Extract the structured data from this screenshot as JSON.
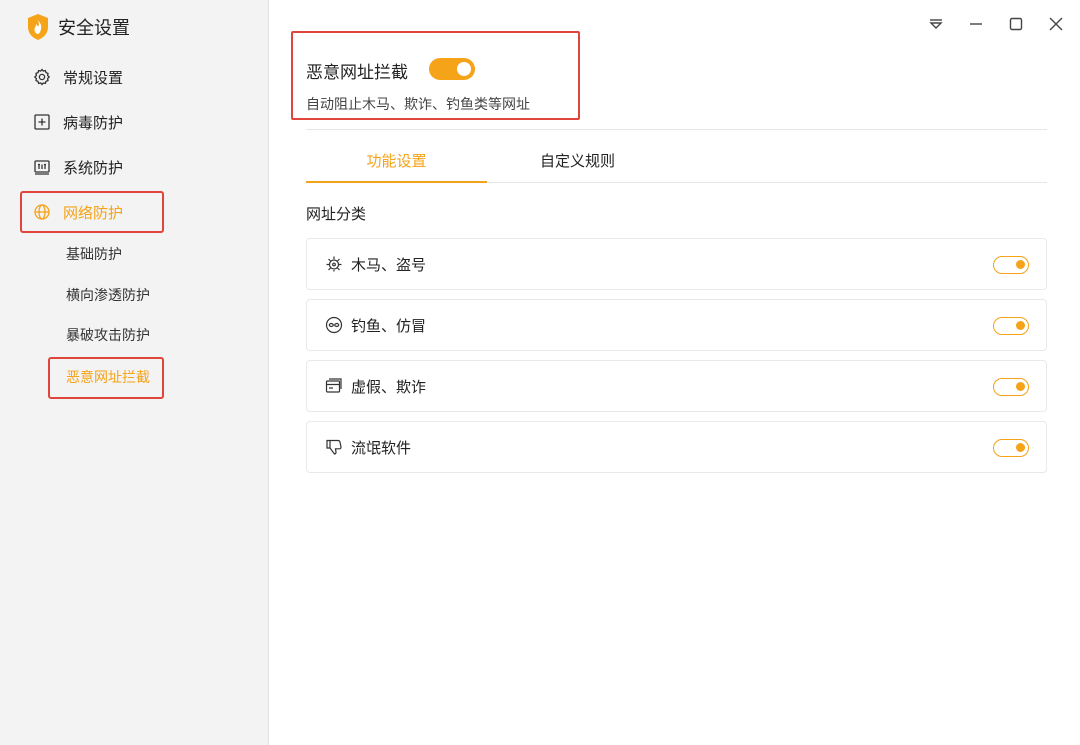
{
  "app": {
    "title": "安全设置",
    "logo_icon": "flame-shield-icon"
  },
  "colors": {
    "accent": "#f5a319",
    "highlight_border": "#e0453b"
  },
  "sidebar": {
    "items": [
      {
        "label": "常规设置",
        "icon": "gear-icon"
      },
      {
        "label": "病毒防护",
        "icon": "plus-square-icon"
      },
      {
        "label": "系统防护",
        "icon": "system-icon"
      },
      {
        "label": "网络防护",
        "icon": "globe-icon",
        "active": true
      }
    ],
    "sub_items": [
      {
        "label": "基础防护"
      },
      {
        "label": "横向渗透防护"
      },
      {
        "label": "暴破攻击防护"
      },
      {
        "label": "恶意网址拦截",
        "active": true
      }
    ]
  },
  "window": {
    "controls": [
      "dropdown-icon",
      "minimize-icon",
      "maximize-icon",
      "close-icon"
    ]
  },
  "header": {
    "title": "恶意网址拦截",
    "enabled": true,
    "description": "自动阻止木马、欺诈、钓鱼类等网址"
  },
  "tabs": [
    {
      "label": "功能设置",
      "active": true
    },
    {
      "label": "自定义规则",
      "active": false
    }
  ],
  "section": {
    "label": "网址分类"
  },
  "categories": [
    {
      "label": "木马、盗号",
      "icon": "bug-icon",
      "enabled": true
    },
    {
      "label": "钓鱼、仿冒",
      "icon": "mask-icon",
      "enabled": true
    },
    {
      "label": "虚假、欺诈",
      "icon": "card-icon",
      "enabled": true
    },
    {
      "label": "流氓软件",
      "icon": "thumbs-down-icon",
      "enabled": true
    }
  ]
}
